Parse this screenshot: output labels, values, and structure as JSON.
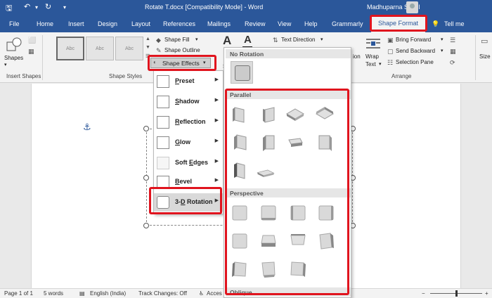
{
  "title_bar": {
    "title": "Rotate T.docx [Compatibility Mode] - Word",
    "user": "Madhuparna Sukul",
    "quick_access": [
      "save-icon",
      "undo-icon",
      "undo-dropdown",
      "redo-icon",
      "customize-icon"
    ]
  },
  "tabs": [
    "File",
    "Home",
    "Insert",
    "Design",
    "Layout",
    "References",
    "Mailings",
    "Review",
    "View",
    "Help",
    "Grammarly",
    "Shape Format"
  ],
  "active_tab": "Shape Format",
  "tell_me": "Tell me",
  "ribbon": {
    "shapes_label": "Shapes",
    "insert_shapes_group": "Insert Shapes",
    "shape_styles_group": "Shape Styles",
    "style_samples": [
      "Abc",
      "Abc",
      "Abc"
    ],
    "shape_fill": "Shape Fill",
    "shape_outline": "Shape Outline",
    "shape_effects": "Shape Effects",
    "text_direction": "Text Direction",
    "wrap_text": [
      "Wrap",
      "Text"
    ],
    "position_partial": "ion",
    "bring_forward": "Bring Forward",
    "send_backward": "Send Backward",
    "selection_pane": "Selection Pane",
    "arrange_group": "Arrange",
    "size_partial": "Size",
    "s_partial": "S"
  },
  "effects_menu": [
    {
      "label": "Preset",
      "accel": "P",
      "rest": "reset"
    },
    {
      "label": "Shadow",
      "accel": "S",
      "rest": "hadow"
    },
    {
      "label": "Reflection",
      "accel": "R",
      "rest": "eflection"
    },
    {
      "label": "Glow",
      "accel": "G",
      "rest": "low"
    },
    {
      "label": "Soft Edges",
      "pre": "Soft ",
      "accel": "E",
      "rest": "dges"
    },
    {
      "label": "Bevel",
      "accel": "B",
      "rest": "evel"
    },
    {
      "label": "3-D Rotation",
      "pre": "3-",
      "accel": "D",
      "rest": " Rotation"
    }
  ],
  "rotation_panel": {
    "no_rotation": "No Rotation",
    "parallel": "Parallel",
    "perspective": "Perspective",
    "oblique": "Oblique"
  },
  "status_bar": {
    "page": "Page 1 of 1",
    "words": "5 words",
    "language": "English (India)",
    "track_changes": "Track Changes: Off",
    "accessibility": "Acces"
  },
  "colors": {
    "brand": "#2b579a",
    "highlight": "#e0141e"
  }
}
